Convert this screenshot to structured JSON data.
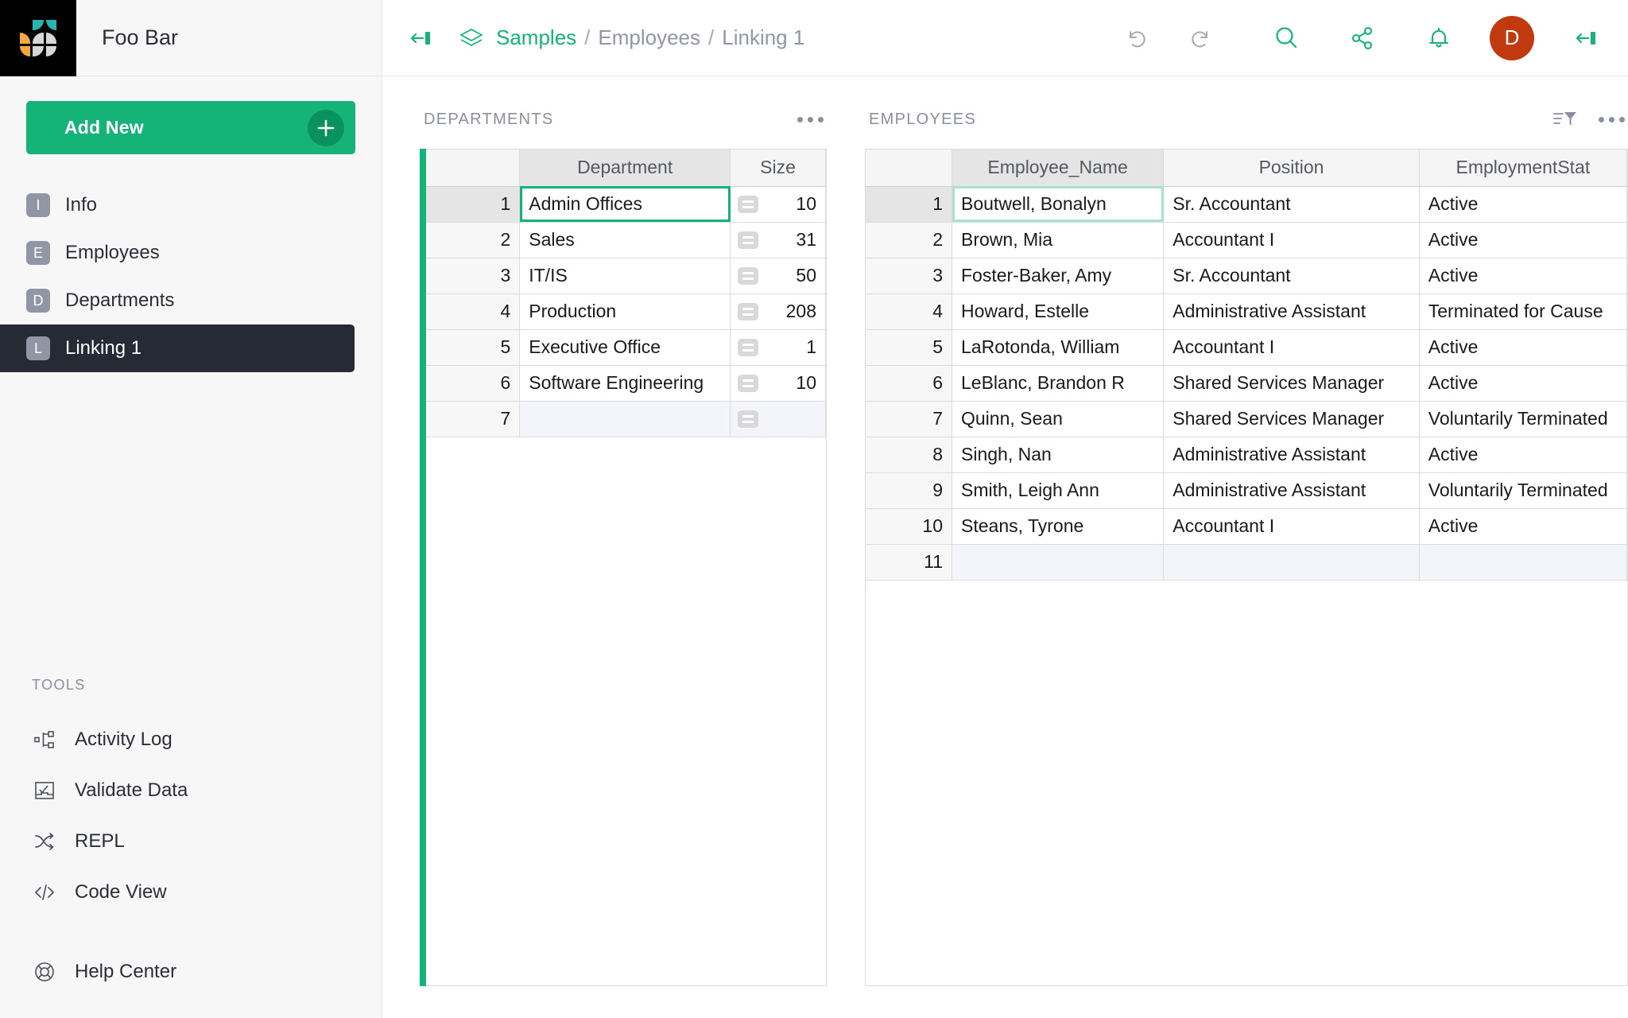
{
  "brand": {
    "name": "Foo Bar",
    "logo_icon": "grist-logo-icon"
  },
  "sidebar": {
    "add_new": {
      "label": "Add New",
      "icon": "plus-icon"
    },
    "pages": [
      {
        "badge": "I",
        "label": "Info",
        "active": false
      },
      {
        "badge": "E",
        "label": "Employees",
        "active": false
      },
      {
        "badge": "D",
        "label": "Departments",
        "active": false
      },
      {
        "badge": "L",
        "label": "Linking 1",
        "active": true
      }
    ],
    "tools_title": "TOOLS",
    "tools": [
      {
        "icon": "activity-log-icon",
        "label": "Activity Log"
      },
      {
        "icon": "validate-data-icon",
        "label": "Validate Data"
      },
      {
        "icon": "repl-icon",
        "label": "REPL"
      },
      {
        "icon": "code-view-icon",
        "label": "Code View"
      }
    ],
    "help": {
      "icon": "life-ring-icon",
      "label": "Help Center"
    }
  },
  "topbar": {
    "collapse_left_icon": "collapse-left-icon",
    "doc_icon": "layers-icon",
    "breadcrumb": {
      "root": "Samples",
      "sep1": "/",
      "page": "Employees",
      "sep2": "/",
      "current": "Linking 1"
    },
    "undo_icon": "undo-icon",
    "redo_icon": "redo-icon",
    "search_icon": "search-icon",
    "share_icon": "share-icon",
    "notify_icon": "bell-icon",
    "avatar_initial": "D",
    "collapse_right_icon": "collapse-right-icon"
  },
  "colors": {
    "accent_green": "#16b378",
    "avatar_red": "#c0390f",
    "active_page_bg": "#262a35",
    "add_row_bg": "#f4f4fb"
  },
  "widgets": {
    "departments": {
      "title": "DEPARTMENTS",
      "menu_icon": "more-options-icon",
      "columns": [
        "Department",
        "Size"
      ],
      "rows": [
        {
          "n": "1",
          "Department": "Admin Offices",
          "Size": "10"
        },
        {
          "n": "2",
          "Department": "Sales",
          "Size": "31"
        },
        {
          "n": "3",
          "Department": "IT/IS",
          "Size": "50"
        },
        {
          "n": "4",
          "Department": "Production",
          "Size": "208"
        },
        {
          "n": "5",
          "Department": "Executive Office",
          "Size": "1"
        },
        {
          "n": "6",
          "Department": "Software Engineering",
          "Size": "10"
        }
      ],
      "add_row_label": "7",
      "selected_row": 1,
      "selected_column": "Department"
    },
    "employees": {
      "title": "EMPLOYEES",
      "sort_filter_icon": "sort-filter-icon",
      "menu_icon": "more-options-icon",
      "columns": [
        "Employee_Name",
        "Position",
        "EmploymentStat"
      ],
      "rows": [
        {
          "n": "1",
          "Employee_Name": "Boutwell, Bonalyn",
          "Position": "Sr. Accountant",
          "EmploymentStatus": "Active"
        },
        {
          "n": "2",
          "Employee_Name": "Brown, Mia",
          "Position": "Accountant I",
          "EmploymentStatus": "Active"
        },
        {
          "n": "3",
          "Employee_Name": "Foster-Baker, Amy",
          "Position": "Sr. Accountant",
          "EmploymentStatus": "Active"
        },
        {
          "n": "4",
          "Employee_Name": "Howard, Estelle",
          "Position": "Administrative Assistant",
          "EmploymentStatus": "Terminated for Cause"
        },
        {
          "n": "5",
          "Employee_Name": "LaRotonda, William",
          "Position": "Accountant I",
          "EmploymentStatus": "Active"
        },
        {
          "n": "6",
          "Employee_Name": "LeBlanc, Brandon  R",
          "Position": "Shared Services Manager",
          "EmploymentStatus": "Active"
        },
        {
          "n": "7",
          "Employee_Name": "Quinn, Sean",
          "Position": "Shared Services Manager",
          "EmploymentStatus": "Voluntarily Terminated"
        },
        {
          "n": "8",
          "Employee_Name": "Singh, Nan",
          "Position": "Administrative Assistant",
          "EmploymentStatus": "Active"
        },
        {
          "n": "9",
          "Employee_Name": "Smith, Leigh Ann",
          "Position": "Administrative Assistant",
          "EmploymentStatus": "Voluntarily Terminated"
        },
        {
          "n": "10",
          "Employee_Name": "Steans, Tyrone",
          "Position": "Accountant I",
          "EmploymentStatus": "Active"
        }
      ],
      "add_row_label": "11",
      "selected_row": 1,
      "selected_column": "Employee_Name"
    }
  }
}
